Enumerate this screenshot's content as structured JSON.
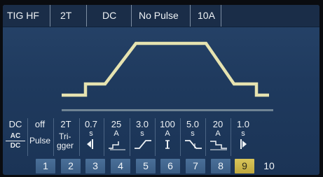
{
  "topbar": {
    "process": "TIG HF",
    "trigger_mode": "2T",
    "current_type": "DC",
    "pulse_mode": "No Pulse",
    "current": "10A"
  },
  "params": [
    {
      "value": "DC",
      "unit": "",
      "icon": "ac-dc-icon"
    },
    {
      "value": "off",
      "unit": "",
      "icon": "pulse-label",
      "label": "Pulse"
    },
    {
      "value": "2T",
      "unit": "",
      "icon": "trigger-label",
      "label_top": "Tri-",
      "label_bottom": "gger"
    },
    {
      "value": "0.7",
      "unit": "s",
      "icon": "gas-preflow-icon"
    },
    {
      "value": "25",
      "unit": "A",
      "icon": "start-current-icon"
    },
    {
      "value": "3.0",
      "unit": "s",
      "icon": "upslope-icon"
    },
    {
      "value": "100",
      "unit": "A",
      "icon": "main-current-icon"
    },
    {
      "value": "5.0",
      "unit": "s",
      "icon": "downslope-icon"
    },
    {
      "value": "20",
      "unit": "A",
      "icon": "end-current-icon"
    },
    {
      "value": "1.0",
      "unit": "s",
      "icon": "gas-postflow-icon"
    }
  ],
  "ac_label": "AC",
  "dc_label": "DC",
  "buttons": [
    "1",
    "2",
    "3",
    "4",
    "5",
    "6",
    "7",
    "8",
    "9",
    "10"
  ],
  "active_button": "9",
  "colors": {
    "curve": "#e6e3b0",
    "active": "#d4bf52",
    "button": "#456a92",
    "background": "#22406a"
  }
}
